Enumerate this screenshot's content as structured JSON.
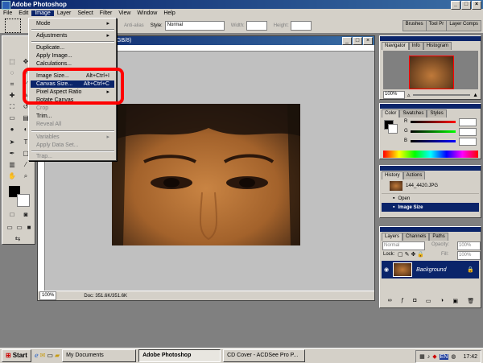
{
  "app": {
    "title": "Adobe Photoshop"
  },
  "menubar": [
    "File",
    "Edit",
    "Image",
    "Layer",
    "Select",
    "Filter",
    "View",
    "Window",
    "Help"
  ],
  "options": {
    "antialias": "Anti-alias",
    "style_label": "Style:",
    "style_value": "Normal",
    "width_label": "Width:",
    "height_label": "Height:"
  },
  "palette_well": [
    "Brushes",
    "Tool Pr",
    "Layer Comps"
  ],
  "document": {
    "title_tail": "GB/8)",
    "zoom": "100%",
    "doc_size": "Doc: 351.6K/351.6K"
  },
  "image_menu": {
    "items": [
      {
        "label": "Mode",
        "shortcut": "",
        "arrow": true
      },
      {
        "label": "Adjustments",
        "shortcut": "",
        "arrow": true
      },
      {
        "label": "Duplicate...",
        "shortcut": ""
      },
      {
        "label": "Apply Image...",
        "shortcut": ""
      },
      {
        "label": "Calculations...",
        "shortcut": ""
      },
      {
        "label": "Image Size...",
        "shortcut": "Alt+Ctrl+I"
      },
      {
        "label": "Canvas Size...",
        "shortcut": "Alt+Ctrl+C"
      },
      {
        "label": "Pixel Aspect Ratio",
        "shortcut": "",
        "arrow": true
      },
      {
        "label": "Rotate Canvas",
        "shortcut": ""
      },
      {
        "label": "Crop",
        "shortcut": ""
      },
      {
        "label": "Trim...",
        "shortcut": ""
      },
      {
        "label": "Reveal All",
        "shortcut": ""
      },
      {
        "label": "Variables",
        "shortcut": "",
        "arrow": true
      },
      {
        "label": "Apply Data Set...",
        "shortcut": ""
      },
      {
        "label": "Trap...",
        "shortcut": ""
      }
    ]
  },
  "navigator": {
    "tabs": [
      "Navigator",
      "Info",
      "Histogram"
    ],
    "zoom": "100%"
  },
  "color": {
    "tabs": [
      "Color",
      "Swatches",
      "Styles"
    ],
    "r_label": "R",
    "g_label": "G",
    "b_label": "B"
  },
  "history": {
    "tabs": [
      "History",
      "Actions"
    ],
    "snapshot": "144_4420.JPG",
    "items": [
      "Open",
      "Image Size"
    ]
  },
  "layers": {
    "tabs": [
      "Layers",
      "Channels",
      "Paths"
    ],
    "blend": "Normal",
    "opacity_label": "Opacity:",
    "opacity": "100%",
    "lock_label": "Lock:",
    "fill_label": "Fill:",
    "fill": "100%",
    "layer_name": "Background"
  },
  "taskbar": {
    "start": "Start",
    "tasks": [
      "My Documents",
      "Adobe Photoshop",
      "CD Cover - ACDSee Pro P..."
    ],
    "lang": "EN",
    "time": "17:42"
  },
  "colors": {
    "accent": "#0a246a",
    "highlight": "#ff0000"
  }
}
